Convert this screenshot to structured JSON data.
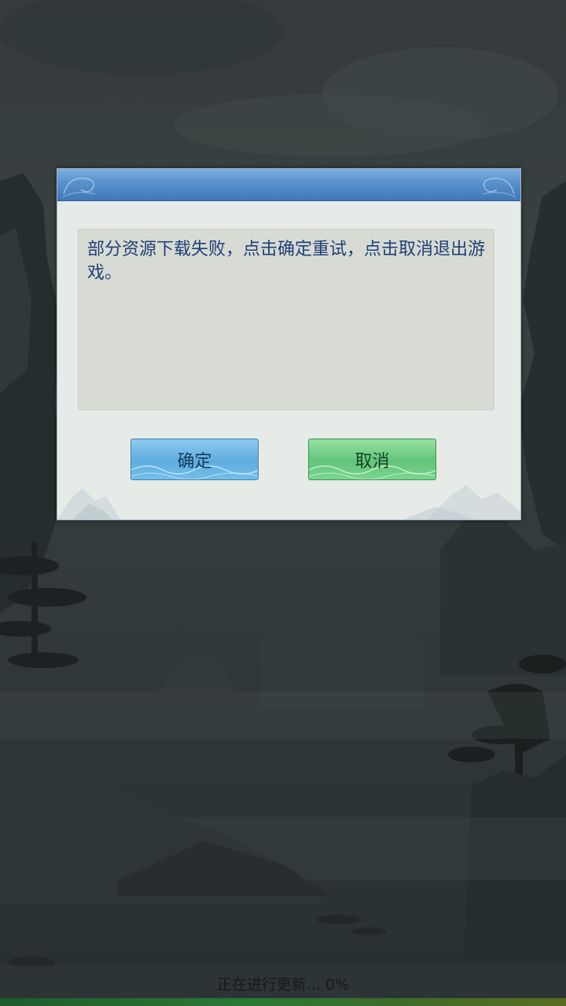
{
  "dialog": {
    "message": "部分资源下载失败，点击确定重试，点击取消退出游戏。",
    "confirm_label": "确定",
    "cancel_label": "取消"
  },
  "status": {
    "text": "正在进行更新... 0%",
    "progress_percent": 0
  },
  "colors": {
    "header_blue": "#4f8ac4",
    "dialog_bg": "#e6ebe8",
    "message_bg": "#d8dbd3",
    "message_text": "#1f3f78",
    "confirm_button": "#5faee0",
    "cancel_button": "#62c47a",
    "progress_bar": "#2a7a36"
  },
  "icons": {
    "background": "ink-landscape-illustration",
    "header_ornament": "cloud-swirl-ornament-icon",
    "dialog_decoration": "misty-mountains-decoration"
  }
}
